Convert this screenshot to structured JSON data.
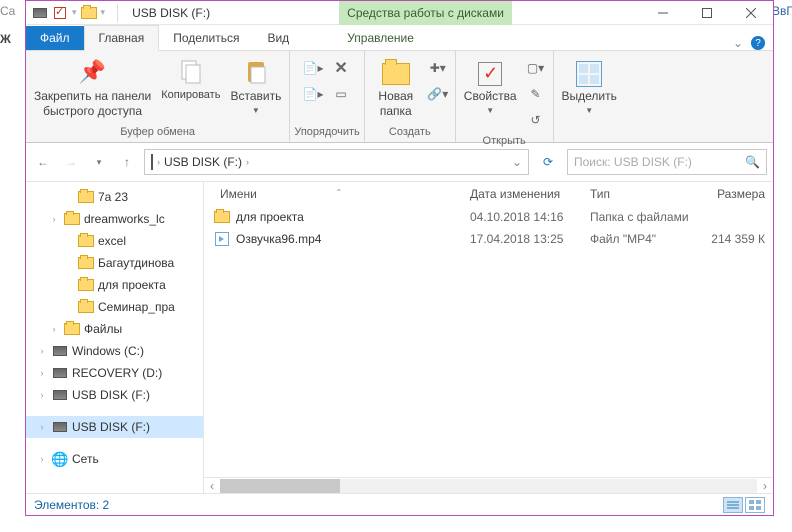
{
  "edges": {
    "left_top": "Ca",
    "left_mid": "Ж",
    "right_top": "ВвГ"
  },
  "title": {
    "path": "USB DISK (F:)",
    "context_tab": "Средства работы с дисками"
  },
  "tabs": {
    "file": "Файл",
    "home": "Главная",
    "share": "Поделиться",
    "view": "Вид",
    "manage": "Управление",
    "expand_caret": "⌄"
  },
  "ribbon": {
    "pin": {
      "line1": "Закрепить на панели",
      "line2": "быстрого доступа"
    },
    "copy": "Копировать",
    "paste": "Вставить",
    "clipboard_group": "Буфер обмена",
    "organize_group": "Упорядочить",
    "newfolder": {
      "line1": "Новая",
      "line2": "папка"
    },
    "create_group": "Создать",
    "properties": "Свойства",
    "open_group": "Открыть",
    "select": "Выделить"
  },
  "address": {
    "segment": "USB DISK (F:)"
  },
  "search": {
    "placeholder": "Поиск: USB DISK (F:)"
  },
  "columns": {
    "name": "Имени",
    "sort_indicator": "ˆ",
    "date": "Дата изменения",
    "type": "Тип",
    "size": "Размера"
  },
  "tree": [
    {
      "indent": 36,
      "exp": "",
      "icon": "folder",
      "label": "7а 23"
    },
    {
      "indent": 22,
      "exp": "›",
      "icon": "folder",
      "label": "dreamworks_lс"
    },
    {
      "indent": 36,
      "exp": "",
      "icon": "folder",
      "label": "excel"
    },
    {
      "indent": 36,
      "exp": "",
      "icon": "folder",
      "label": "Багаутдинова"
    },
    {
      "indent": 36,
      "exp": "",
      "icon": "folder",
      "label": "для проекта"
    },
    {
      "indent": 36,
      "exp": "",
      "icon": "folder",
      "label": "Семинар_пра"
    },
    {
      "indent": 22,
      "exp": "›",
      "icon": "folder",
      "label": "Файлы"
    },
    {
      "indent": 10,
      "exp": "›",
      "icon": "drive",
      "label": "Windows (C:)"
    },
    {
      "indent": 10,
      "exp": "›",
      "icon": "drive",
      "label": "RECOVERY (D:)"
    },
    {
      "indent": 10,
      "exp": "›",
      "icon": "drive",
      "label": "USB DISK (F:)"
    },
    {
      "indent": 10,
      "exp": "›",
      "icon": "drive",
      "label": "USB DISK (F:)",
      "selected": true
    },
    {
      "indent": 10,
      "exp": "›",
      "icon": "net",
      "label": "Сеть"
    }
  ],
  "files": [
    {
      "icon": "folder",
      "name": "для проекта",
      "date": "04.10.2018 14:16",
      "type": "Папка с файлами",
      "size": ""
    },
    {
      "icon": "video",
      "name": "Озвучка96.mp4",
      "date": "17.04.2018 13:25",
      "type": "Файл \"MP4\"",
      "size": "214 359 К"
    }
  ],
  "status": {
    "count_label": "Элементов: 2"
  }
}
